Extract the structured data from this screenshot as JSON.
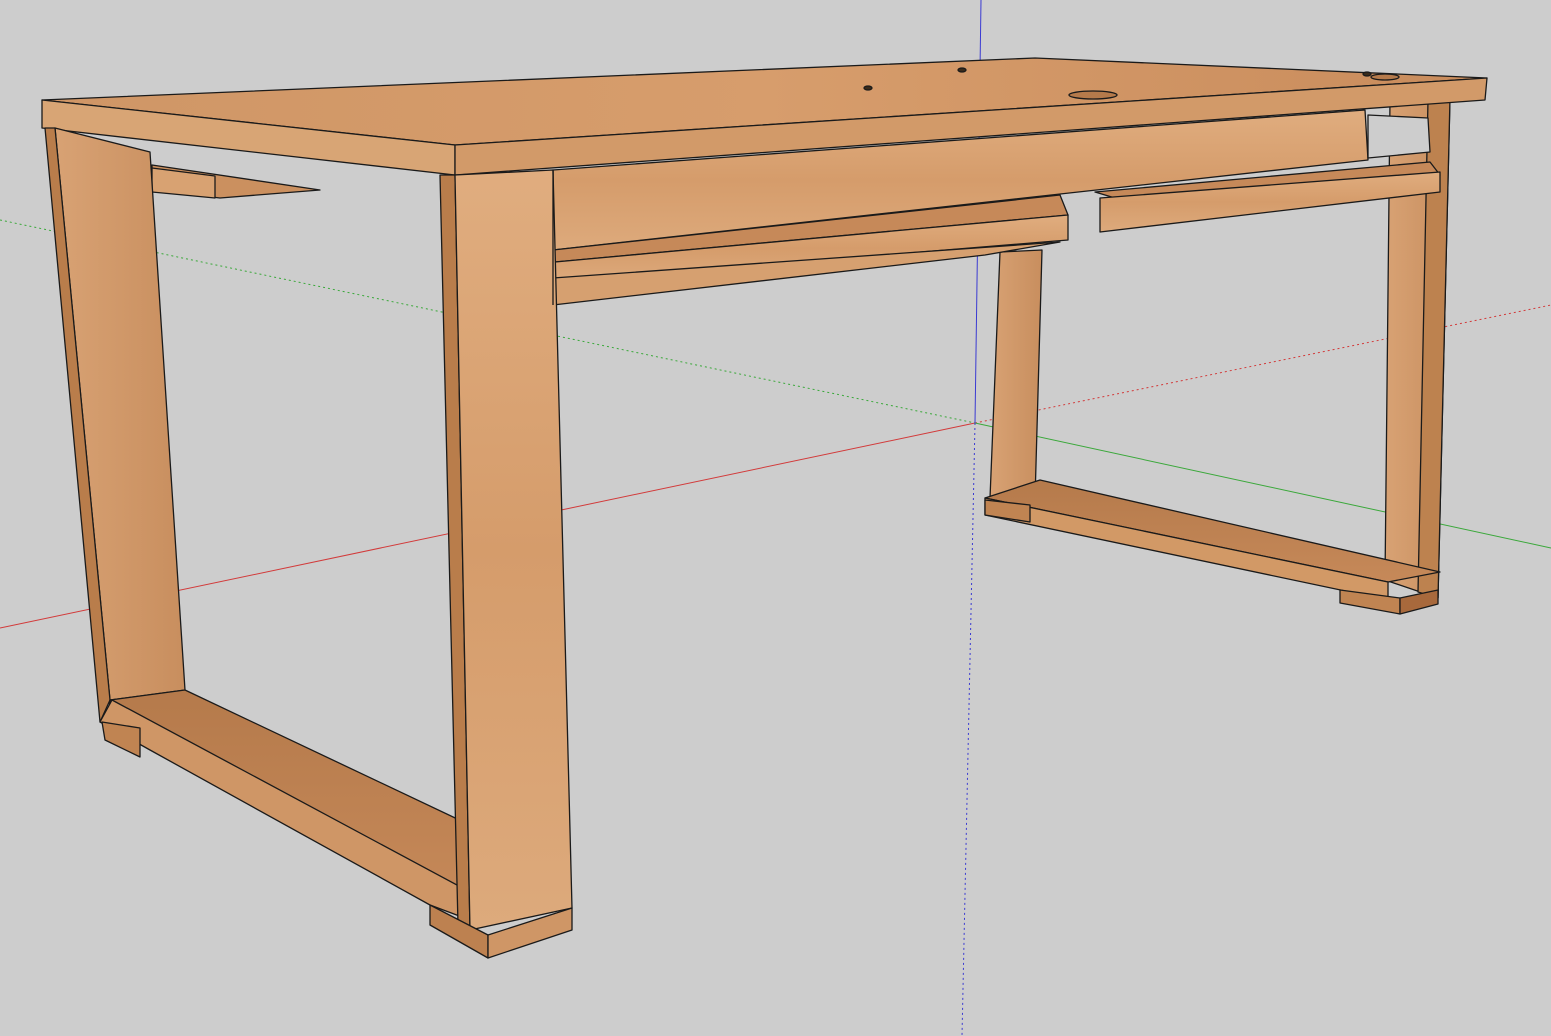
{
  "viewport": {
    "background": "#cdcdcd",
    "axes": {
      "red": "#d23a3a",
      "green": "#3aa83a",
      "blue": "#3a3ad2"
    }
  },
  "model": {
    "wood": {
      "light": "#dca77a",
      "mid": "#cf9462",
      "dark": "#b8794a",
      "shade": "#a8693c",
      "edge": "#1a1a1a"
    }
  }
}
